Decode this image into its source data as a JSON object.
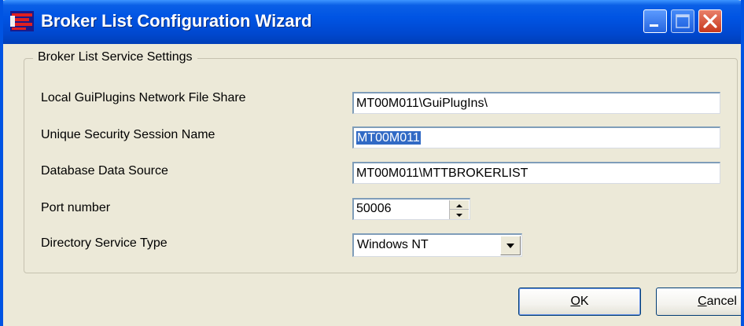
{
  "window": {
    "title": "Broker List Configuration Wizard",
    "icon": "broker-app-icon",
    "controls": [
      "minimize-icon",
      "maximize-icon",
      "close-icon"
    ]
  },
  "group": {
    "legend": "Broker List Service Settings"
  },
  "fields": {
    "file_share": {
      "label": "Local GuiPlugins Network File Share",
      "value": "MT00M011\\GuiPlugIns\\"
    },
    "session_name": {
      "label": "Unique Security Session Name",
      "value": "MT00M011",
      "selected": true
    },
    "data_source": {
      "label": "Database Data Source",
      "value": "MT00M011\\MTTBROKERLIST"
    },
    "port": {
      "label": "Port number",
      "value": "50006"
    },
    "directory_type": {
      "label": "Directory Service Type",
      "value": "Windows NT"
    }
  },
  "buttons": {
    "ok_hotkey": "O",
    "ok_rest": "K",
    "cancel_hotkey": "C",
    "cancel_rest": "ancel"
  },
  "colors": {
    "titlebar": "#0054e3",
    "selection": "#316ac5",
    "dialog_bg": "#ece9d8",
    "close_button": "#c8381c"
  }
}
